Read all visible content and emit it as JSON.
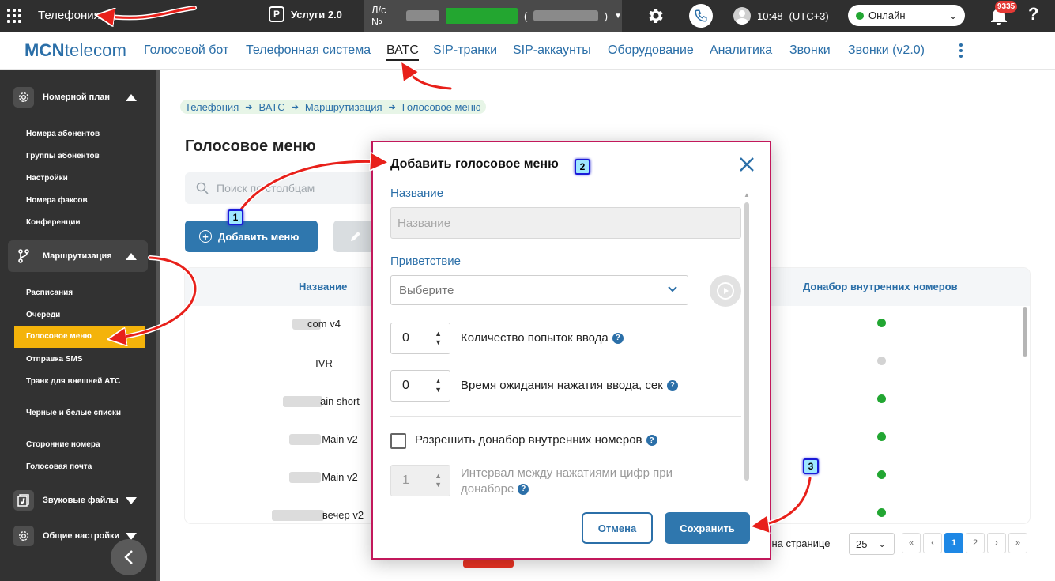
{
  "topbar": {
    "app_title": "Телефония",
    "services_label": "Услуги 2.0",
    "account_prefix": "Л/с №",
    "time": "10:48",
    "timezone": "(UTC+3)",
    "status": "Онлайн",
    "notifications_count": "9335",
    "help": "?"
  },
  "navbar": {
    "logo_bold": "MCN",
    "logo_rest": "telecom",
    "items": [
      {
        "label": "Голосовой бот"
      },
      {
        "label": "Телефонная система"
      },
      {
        "label": "ВАТС"
      },
      {
        "label": "SIP-транки"
      },
      {
        "label": "SIP-аккаунты"
      },
      {
        "label": "Оборудование"
      },
      {
        "label": "Аналитика"
      },
      {
        "label": "Звонки"
      },
      {
        "label": "Звонки (v2.0)"
      }
    ],
    "active_item": "ВАТС"
  },
  "sidebar": {
    "groups": [
      {
        "label": "Номерной план"
      },
      {
        "label": "Маршрутизация"
      },
      {
        "label": "Звуковые файлы"
      },
      {
        "label": "Общие настройки"
      }
    ],
    "numbering_items": [
      {
        "label": "Номера абонентов"
      },
      {
        "label": "Группы абонентов"
      },
      {
        "label": "Настройки"
      },
      {
        "label": "Номера факсов"
      },
      {
        "label": "Конференции"
      }
    ],
    "routing_items": [
      {
        "label": "Расписания"
      },
      {
        "label": "Очереди"
      },
      {
        "label": "Голосовое меню"
      },
      {
        "label": "Отправка SMS"
      },
      {
        "label": "Транк для внешней АТС"
      },
      {
        "label": "Черные и белые списки"
      },
      {
        "label": "Сторонние номера"
      },
      {
        "label": "Голосовая почта"
      }
    ]
  },
  "main": {
    "breadcrumb": [
      "Телефония",
      "ВАТС",
      "Маршрутизация",
      "Голосовое меню"
    ],
    "breadcrumb_sep": "➔",
    "page_title": "Голосовое меню",
    "search_placeholder": "Поиск по столбцам",
    "add_button": "Добавить меню",
    "table": {
      "col_name": "Название",
      "col_donabor": "Донабор внутренних номеров",
      "rows": [
        {
          "name": "com v4",
          "donabor": true
        },
        {
          "name": "IVR",
          "donabor": false
        },
        {
          "name": "ain short",
          "donabor": true
        },
        {
          "name": "Main v2",
          "donabor": true
        },
        {
          "name": "Main v2",
          "donabor": true
        },
        {
          "name": "вечер v2",
          "donabor": true
        }
      ]
    },
    "per_page_label": "в на странице",
    "per_page_value": "25",
    "pages": [
      "«",
      "‹",
      "1",
      "2",
      "›",
      "»"
    ],
    "current_page": "1"
  },
  "modal": {
    "title": "Добавить голосовое меню",
    "name_label": "Название",
    "name_placeholder": "Название",
    "greeting_label": "Приветствие",
    "greeting_placeholder": "Выберите",
    "attempts_value": "0",
    "attempts_label": "Количество попыток ввода",
    "timeout_value": "0",
    "timeout_label": "Время ожидания нажатия ввода, сек",
    "allow_donabor_label": "Разрешить донабор внутренних номеров",
    "interval_value": "1",
    "interval_label": "Интервал между нажатиями цифр при донаборе",
    "cancel_button": "Отмена",
    "save_button": "Сохранить",
    "help_mark": "?"
  },
  "annotations": [
    "1",
    "2",
    "3"
  ],
  "colors": {
    "accent": "#2b6fa8",
    "button": "#2f77ae",
    "sidebar_bg": "#323232",
    "active_item": "#f4b30a",
    "online": "#22a632",
    "annotation_arrow": "#e8201a",
    "modal_border": "#c2185b"
  }
}
